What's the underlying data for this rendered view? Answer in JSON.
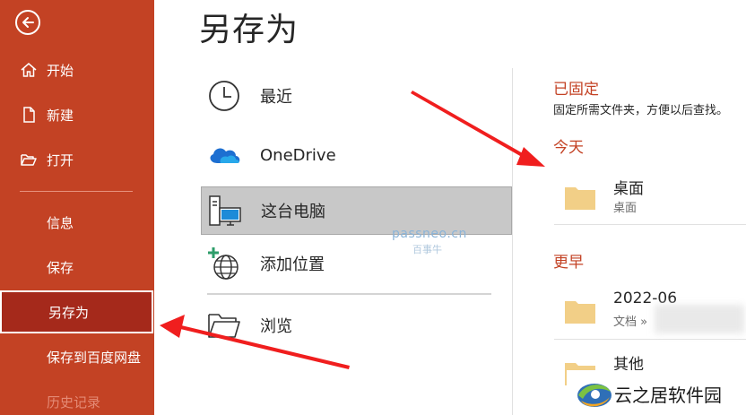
{
  "sidebar": {
    "items": [
      {
        "label": "开始",
        "icon": "home-icon"
      },
      {
        "label": "新建",
        "icon": "new-document-icon"
      },
      {
        "label": "打开",
        "icon": "open-folder-icon"
      },
      {
        "label": "信息"
      },
      {
        "label": "保存"
      },
      {
        "label": "另存为",
        "selected": true
      },
      {
        "label": "保存到百度网盘"
      },
      {
        "label": "历史记录"
      }
    ]
  },
  "main": {
    "title": "另存为",
    "locations": [
      {
        "label": "最近",
        "icon": "clock-icon"
      },
      {
        "label": "OneDrive",
        "icon": "onedrive-cloud-icon"
      },
      {
        "label": "这台电脑",
        "icon": "this-pc-icon",
        "selected": true
      },
      {
        "label": "添加位置",
        "icon": "add-location-globe-icon"
      },
      {
        "label": "浏览",
        "icon": "browse-folder-icon"
      }
    ]
  },
  "right": {
    "pinned_heading": "已固定",
    "pinned_desc": "固定所需文件夹，方便以后查找。",
    "today_heading": "今天",
    "earlier_heading": "更早",
    "folders": [
      {
        "name": "桌面",
        "sub": "桌面"
      },
      {
        "name": "2022-06",
        "sub": "文档 »"
      },
      {
        "name": "其他",
        "sub": ""
      }
    ]
  },
  "watermark": {
    "site": "passneo.cn",
    "site_sub": "百事牛",
    "logo": "云之居软件园"
  },
  "colors": {
    "accent": "#c34224",
    "selected_sidebar": "#a5291b",
    "selected_location": "#c8c8c8",
    "folder": "#f2cf87",
    "arrow": "#f01e1e"
  }
}
